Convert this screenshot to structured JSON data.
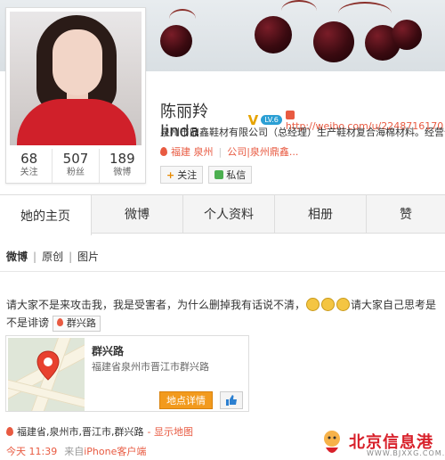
{
  "profile": {
    "name": "陈丽羚linda",
    "verified_badge": "V",
    "level_badge": "LV.6",
    "url": "http://weibo.com/u/2248716170",
    "description": "泉州市鼎鑫鞋材有限公司（总经理）生产鞋材复合海棉材料。经营化工",
    "tag_location": "福建 泉州",
    "tag_company": "公司|泉州鼎鑫...",
    "follow_label": "关注",
    "message_label": "私信",
    "stats": [
      {
        "num": "68",
        "label": "关注"
      },
      {
        "num": "507",
        "label": "粉丝"
      },
      {
        "num": "189",
        "label": "微博"
      }
    ]
  },
  "tabs": [
    {
      "label": "她的主页",
      "active": true
    },
    {
      "label": "微博"
    },
    {
      "label": "个人资料"
    },
    {
      "label": "相册"
    },
    {
      "label": "赞"
    }
  ],
  "subtabs": [
    "微博",
    "原创",
    "图片"
  ],
  "post": {
    "text_part1": "请大家不是来攻击我，我是受害者，为什么删掉我有话说不清，",
    "text_part2": "请大家自己思考是不是诽谤",
    "location_chip": "群兴路",
    "emoji_icons": [
      "cry-face-icon",
      "cry-face-icon",
      "cry-face-icon"
    ]
  },
  "map_card": {
    "title": "群兴路",
    "address": "福建省泉州市晋江市群兴路",
    "detail_button": "地点详情",
    "like_icon": "thumbs-up-icon"
  },
  "location_line": {
    "text": "福建省,泉州市,晋江市,群兴路",
    "show_map": "- 显示地图"
  },
  "meta": {
    "time": "今天 11:39",
    "from": "来自",
    "client": "iPhone客户端"
  },
  "watermark": {
    "name": "北京信息港",
    "url": "WWW.BJXXG.COM."
  },
  "colors": {
    "accent": "#e85a41",
    "orange_button": "#f29a1d",
    "shirt_red": "#d0202a"
  }
}
